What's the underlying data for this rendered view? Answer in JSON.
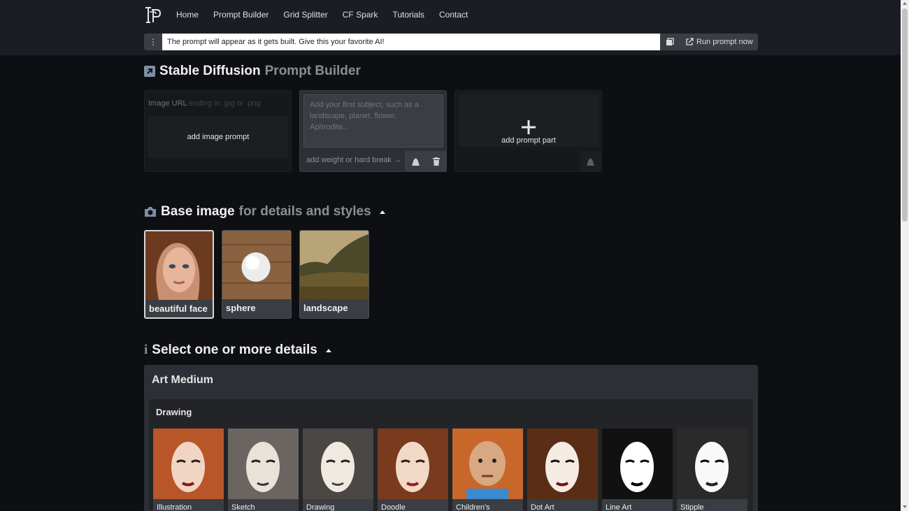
{
  "nav": {
    "items": [
      "Home",
      "Prompt Builder",
      "Grid Splitter",
      "CF Spark",
      "Tutorials",
      "Contact"
    ]
  },
  "prompt_bar": {
    "text": "The prompt will appear as it gets built. Give this your favorite AI!",
    "run_label": "Run prompt now"
  },
  "page_title": {
    "main": "Stable Diffusion",
    "muted": "Prompt Builder"
  },
  "image_card": {
    "url_label": "Image URL",
    "url_placeholder": "ending in .jpg or .png",
    "add_label": "add image prompt"
  },
  "subject_card": {
    "placeholder": "Add your first subject, such as a landscape, planet, flower, Aphrodite...",
    "weight_label": "add weight or hard break"
  },
  "add_part_card": {
    "label": "add prompt part"
  },
  "base_image": {
    "title": "Base image",
    "muted": "for details and styles",
    "tiles": [
      "beautiful face",
      "sphere",
      "landscape"
    ],
    "selected": "beautiful face"
  },
  "details": {
    "title": "Select one or more details"
  },
  "art_medium": {
    "title": "Art Medium",
    "group": "Drawing",
    "styles": [
      "Illustration",
      "Sketch",
      "Drawing",
      "Doodle",
      "Children's",
      "Dot Art",
      "Line Art",
      "Stipple"
    ]
  },
  "colors": {
    "header_bg": "#1a1d23",
    "page_bg": "#0d0f13",
    "panel_bg": "#2c2f35"
  }
}
